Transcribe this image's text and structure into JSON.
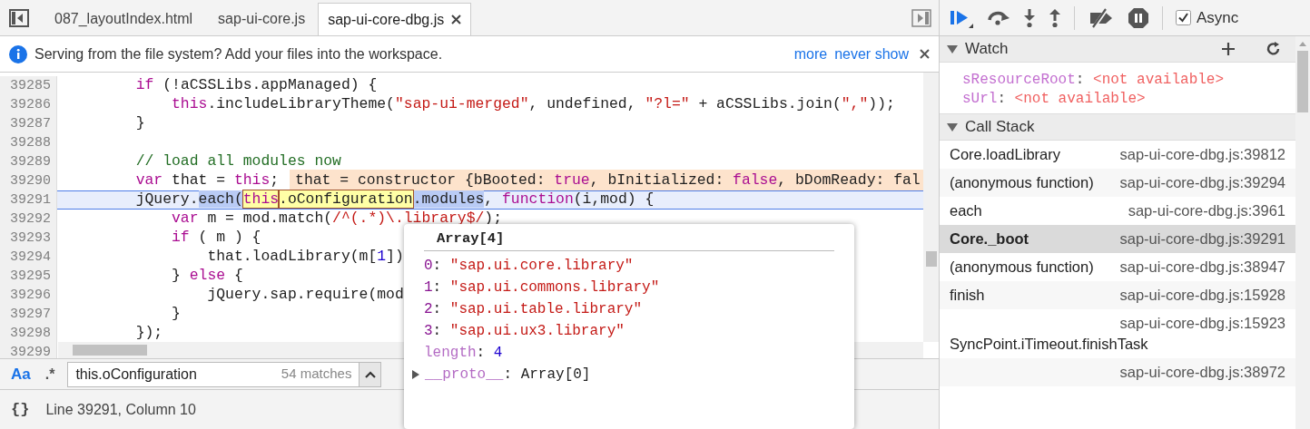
{
  "editor_tabs": [
    {
      "label": "087_layoutIndex.html",
      "selected": false,
      "closable": false
    },
    {
      "label": "sap-ui-core.js",
      "selected": false,
      "closable": false
    },
    {
      "label": "sap-ui-core-dbg.js",
      "selected": true,
      "closable": true
    }
  ],
  "infobar": {
    "message": "Serving from the file system? Add your files into the workspace.",
    "links": [
      "more",
      "never show"
    ]
  },
  "code": {
    "lines": [
      {
        "number": "39285",
        "tokens": [
          {
            "text": "        if",
            "kind": "keyword"
          },
          {
            "text": " (!aCSSLibs.appManaged) {",
            "kind": "plain"
          }
        ]
      },
      {
        "number": "39286",
        "tokens": [
          {
            "text": "            this",
            "kind": "keyword"
          },
          {
            "text": ".includeLibraryTheme(",
            "kind": "plain"
          },
          {
            "text": "\"sap-ui-merged\"",
            "kind": "string"
          },
          {
            "text": ", undefined, ",
            "kind": "plain"
          },
          {
            "text": "\"?l=\"",
            "kind": "string"
          },
          {
            "text": " + aCSSLibs.join(",
            "kind": "plain"
          },
          {
            "text": "\",\"",
            "kind": "string"
          },
          {
            "text": "));",
            "kind": "plain"
          }
        ]
      },
      {
        "number": "39287",
        "tokens": [
          {
            "text": "        }",
            "kind": "plain"
          }
        ]
      },
      {
        "number": "39288"
      },
      {
        "number": "39289",
        "tokens": [
          {
            "text": "        // load all modules now",
            "kind": "comment"
          }
        ]
      },
      {
        "number": "39290",
        "tokens": [
          {
            "text": "        var",
            "kind": "keyword"
          },
          {
            "text": " that = ",
            "kind": "plain"
          },
          {
            "text": "this",
            "kind": "keyword"
          },
          {
            "text": ";",
            "kind": "plain"
          }
        ],
        "inline_value": [
          {
            "text": "that = constructor {bBooted: ",
            "kind": "plain"
          },
          {
            "text": "true",
            "kind": "keyword"
          },
          {
            "text": ", bInitialized: ",
            "kind": "plain"
          },
          {
            "text": "false",
            "kind": "keyword"
          },
          {
            "text": ", bDomReady: fal",
            "kind": "plain"
          }
        ]
      },
      {
        "number": "39291",
        "current": true,
        "tokens": [
          {
            "text": "        jQuery.",
            "kind": "plain",
            "selected": false,
            "matched": false
          },
          {
            "text": "each(",
            "kind": "plain",
            "selected": true,
            "matched": false
          },
          {
            "text": "this",
            "kind": "keyword",
            "matched": true
          },
          {
            "text": ".oConfiguration",
            "kind": "plain",
            "matched": true
          },
          {
            "text": ".modules",
            "kind": "plain",
            "selected": true,
            "matched": false
          },
          {
            "text": ", ",
            "kind": "plain",
            "selected": false,
            "matched": false
          },
          {
            "text": "function",
            "kind": "keyword",
            "selected": false,
            "matched": false
          },
          {
            "text": "(i,mod) {",
            "kind": "plain",
            "selected": false,
            "matched": false
          }
        ]
      },
      {
        "number": "39292",
        "tokens": [
          {
            "text": "            var",
            "kind": "keyword"
          },
          {
            "text": " m = mod.match(",
            "kind": "plain"
          },
          {
            "text": "/^(.*)\\.library$/",
            "kind": "string"
          },
          {
            "text": ");",
            "kind": "plain"
          }
        ]
      },
      {
        "number": "39293",
        "tokens": [
          {
            "text": "            if",
            "kind": "keyword"
          },
          {
            "text": " ( m ) {",
            "kind": "plain"
          }
        ]
      },
      {
        "number": "39294",
        "tokens": [
          {
            "text": "                that.loadLibrary(m[",
            "kind": "plain"
          },
          {
            "text": "1",
            "kind": "number"
          },
          {
            "text": "])",
            "kind": "plain"
          }
        ]
      },
      {
        "number": "39295",
        "tokens": [
          {
            "text": "            } ",
            "kind": "plain"
          },
          {
            "text": "else",
            "kind": "keyword"
          },
          {
            "text": " {",
            "kind": "plain"
          }
        ]
      },
      {
        "number": "39296",
        "tokens": [
          {
            "text": "                jQuery.sap.require(mod",
            "kind": "plain"
          }
        ]
      },
      {
        "number": "39297",
        "tokens": [
          {
            "text": "            }",
            "kind": "plain"
          }
        ]
      },
      {
        "number": "39298",
        "tokens": [
          {
            "text": "        });",
            "kind": "plain"
          }
        ]
      },
      {
        "number": "39299"
      }
    ]
  },
  "search": {
    "case_label": "Aa",
    "case_on": true,
    "regex_label": ".*",
    "regex_on": false,
    "value": "this.oConfiguration",
    "matches": "54 matches"
  },
  "status_bar": {
    "pretty_print_label": "{}",
    "position": "Line 39291, Column 10"
  },
  "popover": {
    "title": "Array[4]",
    "entries": [
      {
        "key": "0",
        "separator": ":",
        "value": "\"sap.ui.core.library\"",
        "kind": "string"
      },
      {
        "key": "1",
        "separator": ":",
        "value": "\"sap.ui.commons.library\"",
        "kind": "string"
      },
      {
        "key": "2",
        "separator": ":",
        "value": "\"sap.ui.table.library\"",
        "kind": "string"
      },
      {
        "key": "3",
        "separator": ":",
        "value": "\"sap.ui.ux3.library\"",
        "kind": "string"
      },
      {
        "key": "length",
        "separator": ":",
        "value": "4",
        "kind": "number"
      },
      {
        "key": "__proto__",
        "separator": ":",
        "value": "Array[0]",
        "kind": "object",
        "expanded": false
      }
    ]
  },
  "debugger_toolbar": {
    "buttons": [
      {
        "kind": "resume"
      },
      {
        "kind": "step_over"
      },
      {
        "kind": "step_into"
      },
      {
        "kind": "step_out"
      },
      {
        "kind": "deactivate_breakpoints"
      },
      {
        "kind": "pause_exceptions"
      }
    ],
    "async": {
      "label": "Async",
      "checked": true
    }
  },
  "watch": {
    "title": "Watch",
    "expanded": true,
    "expressions": [
      {
        "name": "sResourceRoot",
        "separator": ":",
        "value": "<not available>"
      },
      {
        "name": "sUrl",
        "separator": ":",
        "value": "<not available>"
      }
    ]
  },
  "call_stack": {
    "title": "Call Stack",
    "expanded": true,
    "frames": [
      {
        "name": "Core.loadLibrary",
        "location": "sap-ui-core-dbg.js:39812",
        "selected": false
      },
      {
        "name": "(anonymous function)",
        "location": "sap-ui-core-dbg.js:39294",
        "selected": false
      },
      {
        "name": "each",
        "location": "sap-ui-core-dbg.js:3961",
        "selected": false
      },
      {
        "name": "Core._boot",
        "location": "sap-ui-core-dbg.js:39291",
        "selected": true
      },
      {
        "name": "(anonymous function)",
        "location": "sap-ui-core-dbg.js:38947",
        "selected": false
      },
      {
        "name": "finish",
        "location": "sap-ui-core-dbg.js:15928",
        "selected": false
      },
      {
        "name": "SyncPoint.iTimeout.finishTask",
        "location": "sap-ui-core-dbg.js:15923",
        "selected": false
      },
      {
        "location": "sap-ui-core-dbg.js:38972",
        "selected": false
      }
    ]
  }
}
